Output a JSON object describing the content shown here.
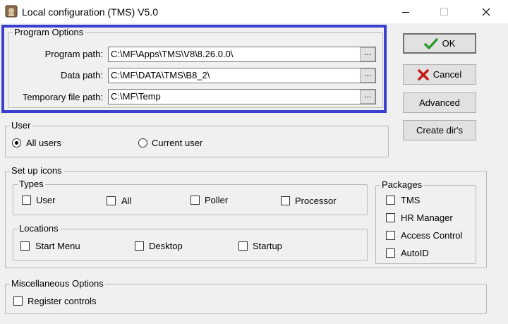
{
  "window": {
    "title": "Local configuration (TMS) V5.0",
    "icon": "app-icon",
    "controls": [
      "minimize-icon",
      "maximize-icon",
      "close-icon"
    ]
  },
  "program_options": {
    "legend": "Program Options",
    "program_path_label": "Program path:",
    "program_path_value": "C:\\MF\\Apps\\TMS\\V8\\8.26.0.0\\",
    "data_path_label": "Data path:",
    "data_path_value": "C:\\MF\\DATA\\TMS\\B8_2\\",
    "temp_path_label": "Temporary file path:",
    "temp_path_value": "C:\\MF\\Temp",
    "browse_label": "..."
  },
  "buttons": {
    "ok": "OK",
    "cancel": "Cancel",
    "advanced": "Advanced",
    "create_dirs": "Create dir's"
  },
  "user": {
    "legend": "User",
    "all_users": "All users",
    "current_user": "Current user",
    "selected": "all_users"
  },
  "setup_icons": {
    "legend": "Set up icons",
    "types": {
      "legend": "Types",
      "user": "User",
      "all": "All",
      "poller": "Poller",
      "processor": "Processor"
    },
    "locations": {
      "legend": "Locations",
      "start_menu": "Start Menu",
      "desktop": "Desktop",
      "startup": "Startup"
    },
    "packages": {
      "legend": "Packages",
      "tms": "TMS",
      "hr_manager": "HR Manager",
      "access_control": "Access Control",
      "autoid": "AutoID"
    }
  },
  "misc": {
    "legend": "Miscellaneous Options",
    "register_controls": "Register controls"
  },
  "colors": {
    "highlight_border": "#3b3fd0",
    "ok_check": "#2e9a2e",
    "cancel_x": "#c81818",
    "dialog_bg": "#f0f0f0"
  }
}
